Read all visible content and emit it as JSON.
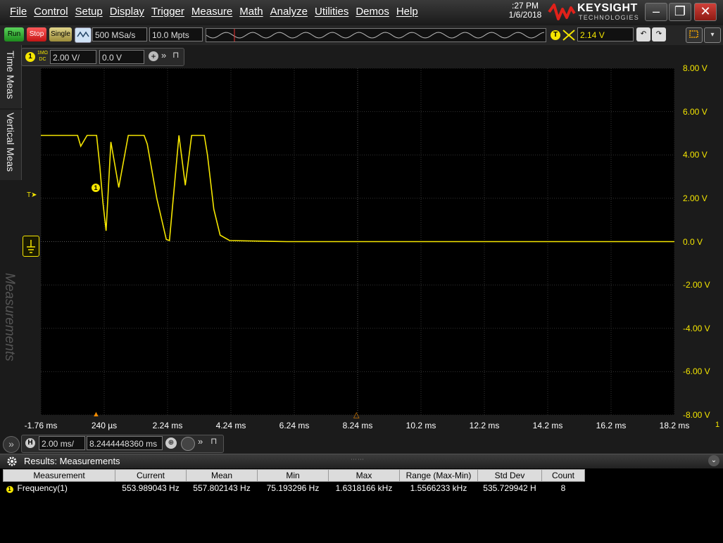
{
  "menu": {
    "items": [
      "File",
      "Control",
      "Setup",
      "Display",
      "Trigger",
      "Measure",
      "Math",
      "Analyze",
      "Utilities",
      "Demos",
      "Help"
    ]
  },
  "clock": {
    "time": ":27 PM",
    "date": "1/6/2018"
  },
  "brand": {
    "name": "KEYSIGHT",
    "tagline": "TECHNOLOGIES"
  },
  "toolbar": {
    "run": "Run",
    "stop": "Stop",
    "single": "Single",
    "sample_rate": "500 MSa/s",
    "memory_depth": "10.0 Mpts",
    "trigger_badge": "T",
    "trigger_level": "2.14 V"
  },
  "channel": {
    "badge": "1",
    "coupling_top": "1MΩ",
    "coupling_bottom": "DC",
    "scale": "2.00 V/",
    "offset": "0.0 V"
  },
  "side_tabs": {
    "time_meas": "Time Meas",
    "vertical_meas": "Vertical Meas",
    "measurements": "Measurements"
  },
  "trigger_marker": "T",
  "horizontal": {
    "badge": "H",
    "scale": "2.00 ms/",
    "position": "8.2444448360 ms"
  },
  "results": {
    "title": "Results: Measurements",
    "columns": [
      "Measurement",
      "Current",
      "Mean",
      "Min",
      "Max",
      "Range (Max-Min)",
      "Std Dev",
      "Count"
    ],
    "rows": [
      {
        "badge": "1",
        "name": "Frequency(1)",
        "current": "553.989043 Hz",
        "mean": "557.802143 Hz",
        "min": "75.193296 Hz",
        "max": "1.6318166 kHz",
        "range": "1.5566233 kHz",
        "stddev": "535.729942 H",
        "count": "8"
      }
    ]
  },
  "chart_data": {
    "type": "line",
    "title": "",
    "xlabel": "",
    "ylabel": "",
    "x_ticks": [
      "-1.76 ms",
      "240 µs",
      "2.24 ms",
      "4.24 ms",
      "6.24 ms",
      "8.24 ms",
      "10.2 ms",
      "12.2 ms",
      "14.2 ms",
      "16.2 ms",
      "18.2 ms"
    ],
    "y_ticks": [
      "8.00 V",
      "6.00 V",
      "4.00 V",
      "2.00 V",
      "0.0 V",
      "-2.00 V",
      "-4.00 V",
      "-6.00 V",
      "-8.00 V"
    ],
    "xlim_ms": [
      -1.76,
      18.24
    ],
    "ylim": [
      -8,
      8
    ],
    "grid": true,
    "series_color": "#f5e600",
    "series": [
      {
        "name": "",
        "x_ms": [
          -1.76,
          -0.6,
          -0.5,
          -0.3,
          0.0,
          0.1,
          0.2,
          0.3,
          0.45,
          0.7,
          1.0,
          1.3,
          1.5,
          1.6,
          1.9,
          2.2,
          2.3,
          2.6,
          2.8,
          3.0,
          3.2,
          3.4,
          3.5,
          3.7,
          3.9,
          4.2,
          6.0,
          9.0,
          12.0,
          15.0,
          18.24
        ],
        "y_v": [
          4.9,
          4.9,
          4.4,
          4.9,
          4.9,
          3.5,
          1.8,
          0.5,
          4.6,
          2.5,
          4.9,
          4.9,
          4.9,
          4.5,
          2.0,
          0.1,
          0.05,
          4.9,
          2.6,
          4.9,
          4.9,
          4.9,
          4.0,
          1.5,
          0.3,
          0.05,
          0.0,
          0.0,
          0.0,
          0.0,
          0.0
        ]
      }
    ]
  }
}
